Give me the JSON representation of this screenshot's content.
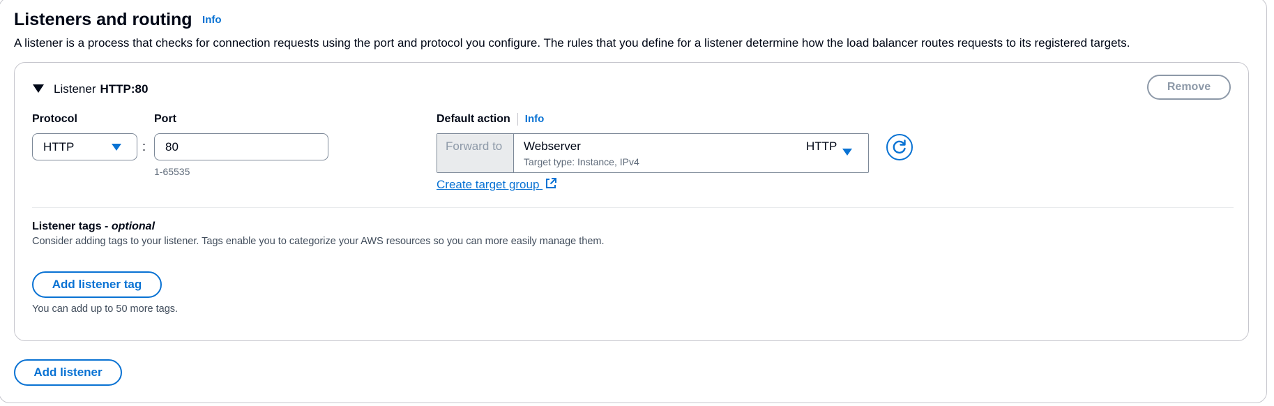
{
  "section": {
    "title": "Listeners and routing",
    "info_label": "Info",
    "description": "A listener is a process that checks for connection requests using the port and protocol you configure. The rules that you define for a listener determine how the load balancer routes requests to its registered targets."
  },
  "listener": {
    "heading_prefix": "Listener",
    "heading_value": "HTTP:80",
    "remove_label": "Remove",
    "protocol": {
      "label": "Protocol",
      "value": "HTTP"
    },
    "separator": ":",
    "port": {
      "label": "Port",
      "value": "80",
      "hint": "1-65535"
    },
    "default_action": {
      "label": "Default action",
      "info_label": "Info",
      "forward_prefix": "Forward to",
      "target_group_name": "Webserver",
      "target_group_type": "Target type: Instance, IPv4",
      "target_group_protocol": "HTTP",
      "create_link": "Create target group"
    },
    "tags": {
      "title": "Listener tags - ",
      "title_optional": "optional",
      "description": "Consider adding tags to your listener. Tags enable you to categorize your AWS resources so you can more easily manage them.",
      "add_button": "Add listener tag",
      "note": "You can add up to 50 more tags."
    }
  },
  "add_listener_label": "Add listener",
  "icons": {
    "expand": "caret-down-icon",
    "dropdown": "triangle-down-icon",
    "refresh": "refresh-icon",
    "external": "external-link-icon"
  },
  "colors": {
    "accent": "#0972d3",
    "border": "#7d8998",
    "disabled_text": "#8d99a8",
    "text": "#000716"
  }
}
